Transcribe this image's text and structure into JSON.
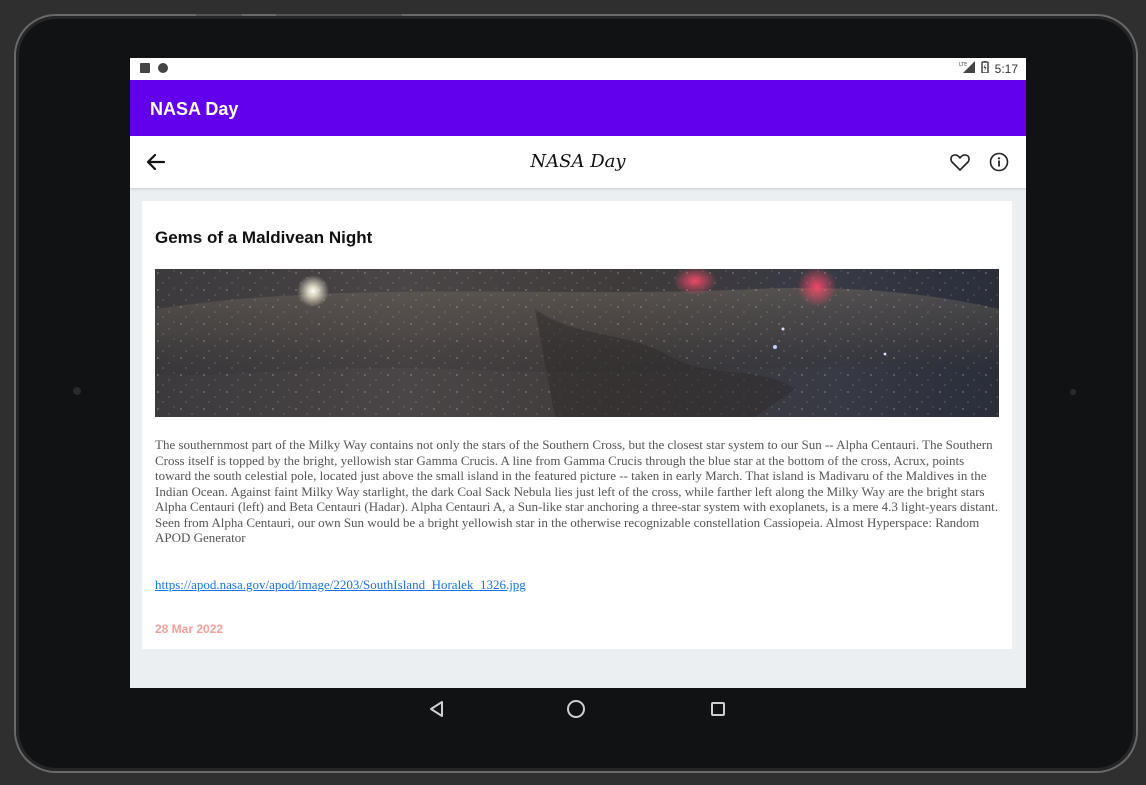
{
  "statusbar": {
    "time": "5:17",
    "network": "LTE"
  },
  "appbar": {
    "title": "NASA Day",
    "color": "#6200ee"
  },
  "toolbar": {
    "title": "NASA Day",
    "back_icon": "arrow-left-icon",
    "favorite_icon": "heart-outline-icon",
    "info_icon": "info-circle-icon"
  },
  "article": {
    "title": "Gems of a Maldivean Night",
    "image_alt_icon": "milky-way-panorama-image",
    "description": "The southernmost part of the Milky Way contains not only the stars of the Southern Cross, but the closest star system to our Sun -- Alpha Centauri.  The Southern Cross itself is topped by the bright, yellowish star Gamma Crucis.  A line from Gamma Crucis through the blue star at the bottom of the cross, Acrux, points toward the south celestial pole, located just above the small island in the featured picture -- taken in early March.  That island is Madivaru of the Maldives in the Indian Ocean. Against faint Milky Way starlight, the dark Coal Sack Nebula lies just left of the cross, while farther left along the Milky Way are the bright stars Alpha Centauri (left) and Beta Centauri (Hadar).  Alpha Centauri A, a Sun-like star anchoring a three-star system with exoplanets, is a mere 4.3 light-years distant.  Seen from Alpha Centauri, our own Sun would be a bright yellowish star in the otherwise recognizable constellation Cassiopeia.   Almost Hyperspace: Random APOD Generator",
    "link": "https://apod.nasa.gov/apod/image/2203/SouthIsland_Horalek_1326.jpg",
    "date": "28 Mar 2022",
    "date_color": "#f4a09a"
  },
  "navbar": {
    "back_icon": "nav-back-triangle-icon",
    "home_icon": "nav-home-circle-icon",
    "recent_icon": "nav-recents-square-icon"
  }
}
